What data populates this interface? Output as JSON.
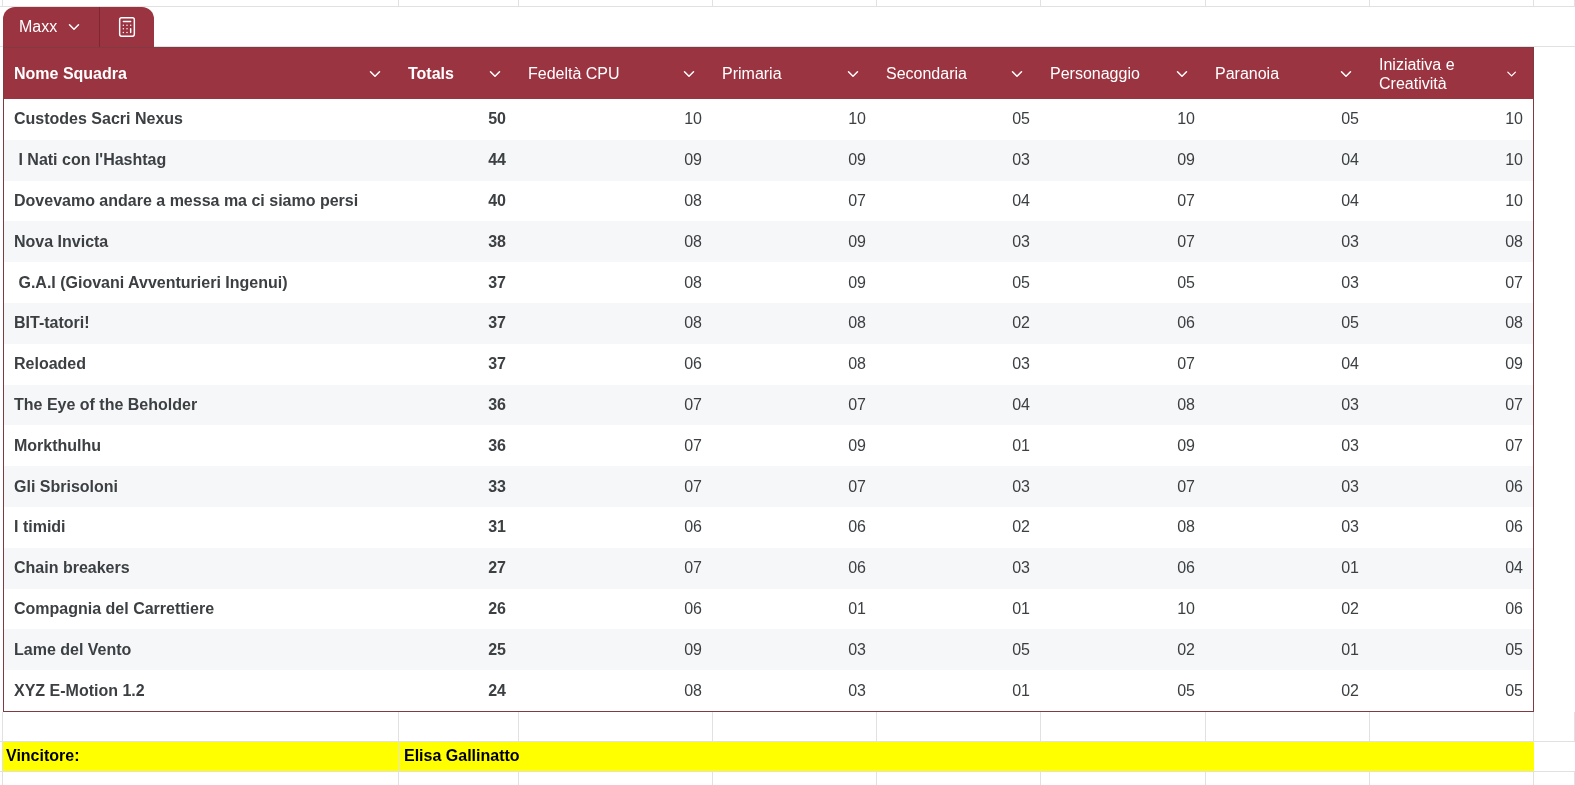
{
  "table_tab": {
    "name": "Maxx"
  },
  "table": {
    "columns": [
      {
        "label": "Nome Squadra",
        "bold": true
      },
      {
        "label": "Totals",
        "bold": true
      },
      {
        "label": "Fedeltà CPU",
        "bold": false
      },
      {
        "label": "Primaria",
        "bold": false
      },
      {
        "label": "Secondaria",
        "bold": false
      },
      {
        "label": "Personaggio",
        "bold": false
      },
      {
        "label": "Paranoia",
        "bold": false
      },
      {
        "label": "Iniziativa e Creatività",
        "bold": false
      }
    ],
    "rows": [
      {
        "team": "Custodes Sacri Nexus",
        "total": "50",
        "scores": [
          "10",
          "10",
          "05",
          "10",
          "05",
          "10"
        ]
      },
      {
        "team": " I Nati con l'Hashtag",
        "total": "44",
        "scores": [
          "09",
          "09",
          "03",
          "09",
          "04",
          "10"
        ]
      },
      {
        "team": "Dovevamo andare a messa ma ci siamo persi",
        "total": "40",
        "scores": [
          "08",
          "07",
          "04",
          "07",
          "04",
          "10"
        ]
      },
      {
        "team": "Nova Invicta",
        "total": "38",
        "scores": [
          "08",
          "09",
          "03",
          "07",
          "03",
          "08"
        ]
      },
      {
        "team": " G.A.I (Giovani Avventurieri Ingenui)",
        "total": "37",
        "scores": [
          "08",
          "09",
          "05",
          "05",
          "03",
          "07"
        ]
      },
      {
        "team": "BIT-tatori!",
        "total": "37",
        "scores": [
          "08",
          "08",
          "02",
          "06",
          "05",
          "08"
        ]
      },
      {
        "team": "Reloaded",
        "total": "37",
        "scores": [
          "06",
          "08",
          "03",
          "07",
          "04",
          "09"
        ]
      },
      {
        "team": "The Eye of the Beholder",
        "total": "36",
        "scores": [
          "07",
          "07",
          "04",
          "08",
          "03",
          "07"
        ]
      },
      {
        "team": "Morkthulhu",
        "total": "36",
        "scores": [
          "07",
          "09",
          "01",
          "09",
          "03",
          "07"
        ]
      },
      {
        "team": "Gli Sbrisoloni",
        "total": "33",
        "scores": [
          "07",
          "07",
          "03",
          "07",
          "03",
          "06"
        ]
      },
      {
        "team": "I timidi",
        "total": "31",
        "scores": [
          "06",
          "06",
          "02",
          "08",
          "03",
          "06"
        ]
      },
      {
        "team": "Chain breakers",
        "total": "27",
        "scores": [
          "07",
          "06",
          "03",
          "06",
          "01",
          "04"
        ]
      },
      {
        "team": "Compagnia del Carrettiere",
        "total": "26",
        "scores": [
          "06",
          "01",
          "01",
          "10",
          "02",
          "06"
        ]
      },
      {
        "team": "Lame del Vento",
        "total": "25",
        "scores": [
          "09",
          "03",
          "05",
          "02",
          "01",
          "05"
        ]
      },
      {
        "team": "XYZ E-Motion 1.2",
        "total": "24",
        "scores": [
          "08",
          "03",
          "01",
          "05",
          "02",
          "05"
        ]
      }
    ]
  },
  "winner": {
    "label": "Vincitore:",
    "name": "Elisa Gallinatto"
  }
}
